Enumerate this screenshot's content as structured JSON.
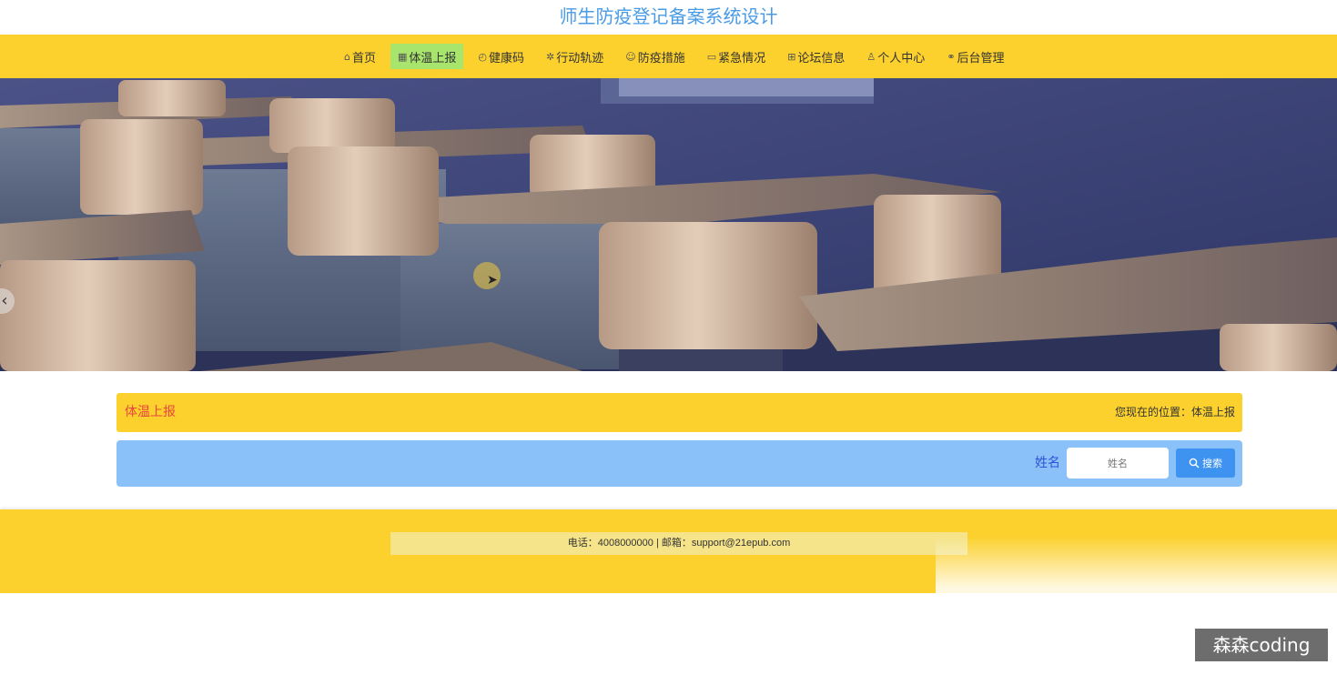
{
  "site": {
    "title": "师生防疫登记备案系统设计"
  },
  "nav": {
    "items": [
      {
        "icon": "home-icon",
        "glyph": "⌂",
        "label": "首页",
        "active": false
      },
      {
        "icon": "calendar-icon",
        "glyph": "▦",
        "label": "体温上报",
        "active": true
      },
      {
        "icon": "dashboard-icon",
        "glyph": "◴",
        "label": "健康码",
        "active": false
      },
      {
        "icon": "loading-icon",
        "glyph": "✲",
        "label": "行动轨迹",
        "active": false
      },
      {
        "icon": "smile-icon",
        "glyph": "☺",
        "label": "防疫措施",
        "active": false
      },
      {
        "icon": "read-icon",
        "glyph": "▭",
        "label": "紧急情况",
        "active": false
      },
      {
        "icon": "gift-icon",
        "glyph": "⊞",
        "label": "论坛信息",
        "active": false
      },
      {
        "icon": "user-icon",
        "glyph": "♙",
        "label": "个人中心",
        "active": false
      },
      {
        "icon": "link-icon",
        "glyph": "⚭",
        "label": "后台管理",
        "active": false
      }
    ]
  },
  "banner": {
    "arrow_glyph": "‹",
    "slide_count": 3,
    "active_slide": 1
  },
  "breadcrumb": {
    "title": "体温上报",
    "location": "您现在的位置：体温上报"
  },
  "search": {
    "label": "姓名",
    "placeholder": "姓名",
    "value": "",
    "button_label": "搜索",
    "button_icon": "search-icon"
  },
  "footer": {
    "contact": "电话：4008000000 | 邮箱：support@21epub.com"
  },
  "watermark": {
    "text": "森森coding"
  },
  "colors": {
    "accent": "#fcd12e",
    "active_nav": "#a7e56d",
    "title": "#4a9be6",
    "search_bar": "#89c1f8",
    "button": "#3e93f0",
    "breadcrumb_title": "#e8453c"
  }
}
